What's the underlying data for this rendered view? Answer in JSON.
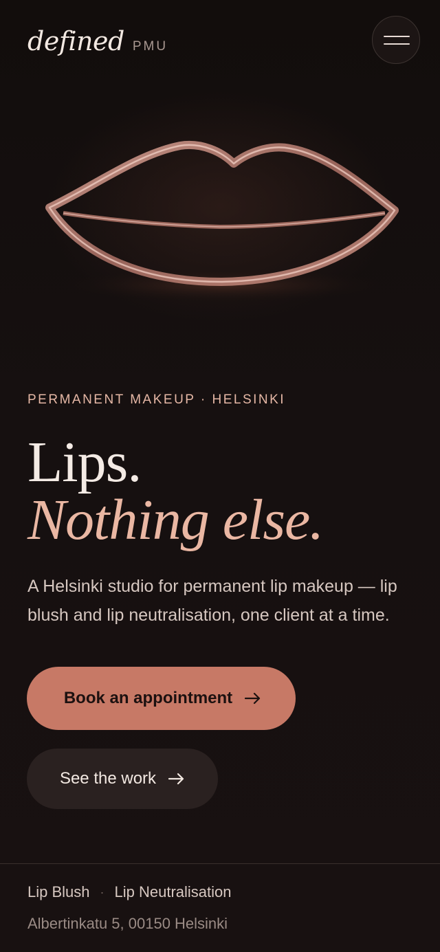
{
  "header": {
    "logo_word": "defined",
    "logo_suffix": "PMU",
    "menu_icon": "hamburger-menu-icon"
  },
  "hero": {
    "image_subject": "glass-lips-outline",
    "eyebrow": "PERMANENT MAKEUP · HELSINKI",
    "headline_line1": "Lips.",
    "headline_line2": "Nothing else.",
    "intro": "A Helsinki studio for permanent lip makeup — lip blush and lip neutralisation, one client at a time."
  },
  "actions": {
    "primary_label": "Book an appointment",
    "secondary_label": "See the work",
    "arrow_icon": "arrow-right-icon"
  },
  "footer": {
    "services": [
      "Lip Blush",
      "Lip Neutralisation"
    ],
    "separator": "·",
    "address": "Albertinkatu 5, 00150 Helsinki"
  },
  "colors": {
    "background": "#140e0d",
    "accent": "#c77966",
    "accent_light": "#eab7a3",
    "text": "#f4ebe5",
    "secondary_button": "#2a2120"
  }
}
